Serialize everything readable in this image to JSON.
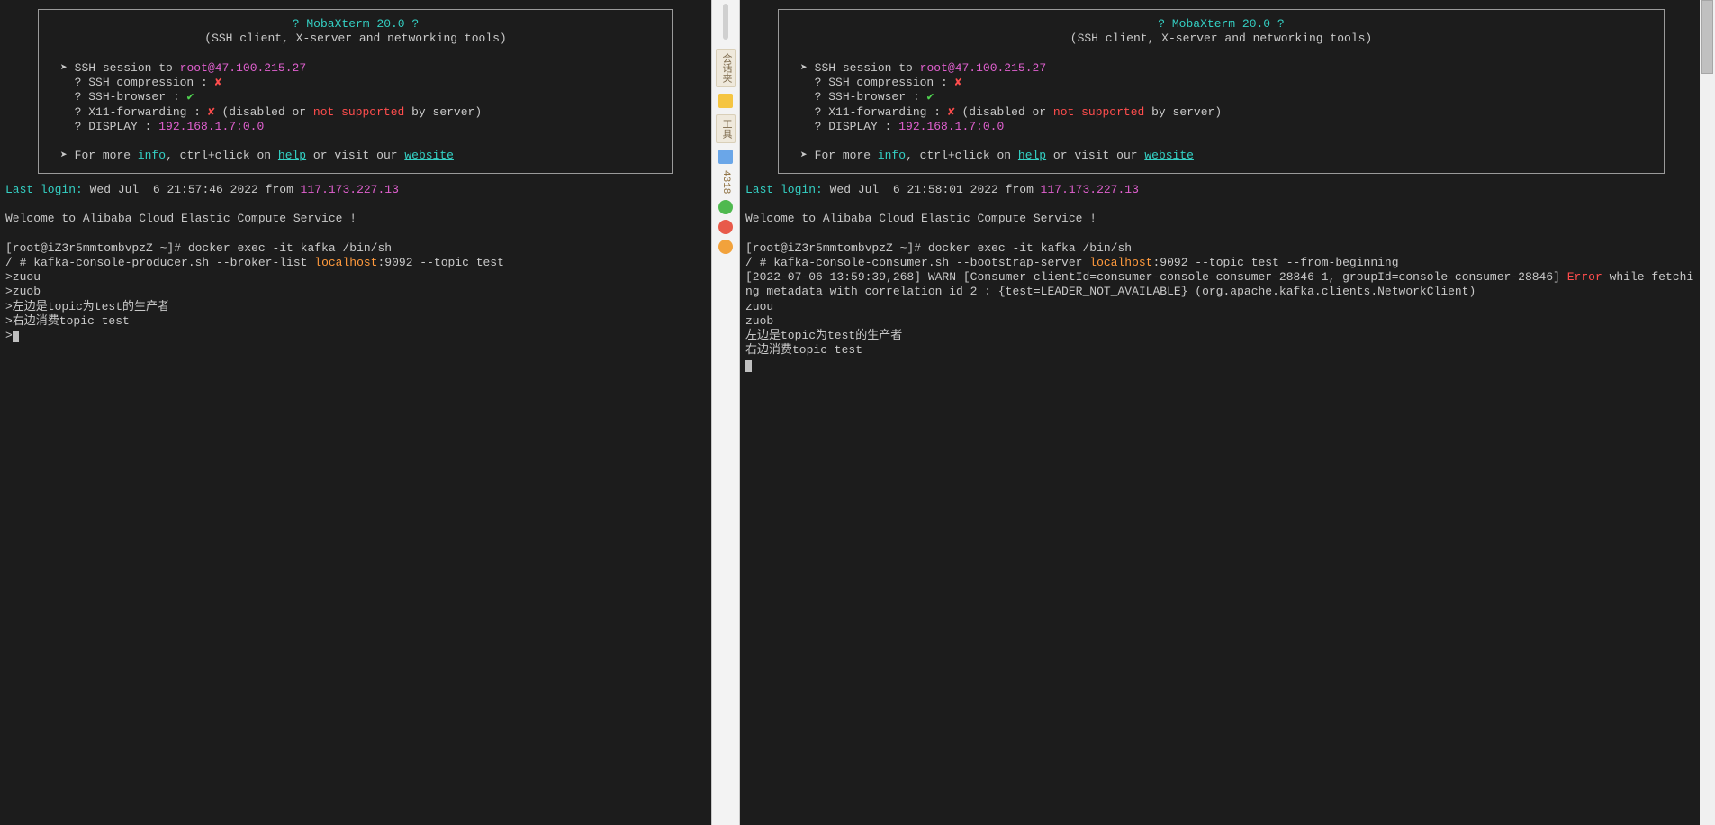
{
  "banner": {
    "title_line": "? MobaXterm 20.0 ?",
    "subtitle": "(SSH client, X-server and networking tools)",
    "session_prefix": "SSH session to ",
    "session_user": "root",
    "session_at": "@",
    "session_host": "47.100.215.27",
    "compression_label": "? SSH compression : ",
    "compression_mark": "✘",
    "browser_label": "? SSH-browser     : ",
    "browser_mark": "✔",
    "x11_label": "? X11-forwarding  : ",
    "x11_mark": "✘",
    "x11_note_open": "  (disabled or ",
    "x11_note_red": "not supported",
    "x11_note_close": " by server)",
    "display_label": "? DISPLAY         : ",
    "display_value": "192.168.1.7:0.0",
    "more_prefix": "For more ",
    "more_info": "info",
    "more_mid": ", ctrl+click on ",
    "more_help": "help",
    "more_or": " or visit our ",
    "more_website": "website"
  },
  "left": {
    "lastlogin_label": "Last login:",
    "lastlogin_time": " Wed Jul  6 21:57:46 2022 from ",
    "lastlogin_ip": "117.173.227.13",
    "welcome": "Welcome to Alibaba Cloud Elastic Compute Service !",
    "prompt1": "[root@iZ3r5mmtombvpzZ ~]# docker exec -it kafka /bin/sh",
    "line2_a": "/ # kafka-console-producer.sh --broker-list ",
    "line2_host": "localhost",
    "line2_b": ":9092 --topic test",
    "p1": ">zuou",
    "p2": ">zuob",
    "p3": ">左边是topic为test的生产者",
    "p4": ">右边消费topic test",
    "p5": ">"
  },
  "right": {
    "lastlogin_label": "Last login:",
    "lastlogin_time": " Wed Jul  6 21:58:01 2022 from ",
    "lastlogin_ip": "117.173.227.13",
    "welcome": "Welcome to Alibaba Cloud Elastic Compute Service !",
    "prompt1": "[root@iZ3r5mmtombvpzZ ~]# docker exec -it kafka /bin/sh",
    "line2_a": "/ # kafka-console-consumer.sh --bootstrap-server ",
    "line2_host": "localhost",
    "line2_b": ":9092 --topic test --from-beginning",
    "warn_a": "[2022-07-06 13:59:39,268] WARN [Consumer clientId=consumer-console-consumer-28846-1, groupId=console-consumer-28846] ",
    "warn_err": "Error",
    "warn_b": " while fetching metadata with correlation id 2 : {test=LEADER_NOT_AVAILABLE} (org.apache.kafka.clients.NetworkClient)",
    "o1": "zuou",
    "o2": "zuob",
    "o3": "左边是topic为test的生产者",
    "o4": "右边消费topic test"
  },
  "sidebar": {
    "tab1": "会话夹",
    "tab2": "工具",
    "num": "4318"
  }
}
